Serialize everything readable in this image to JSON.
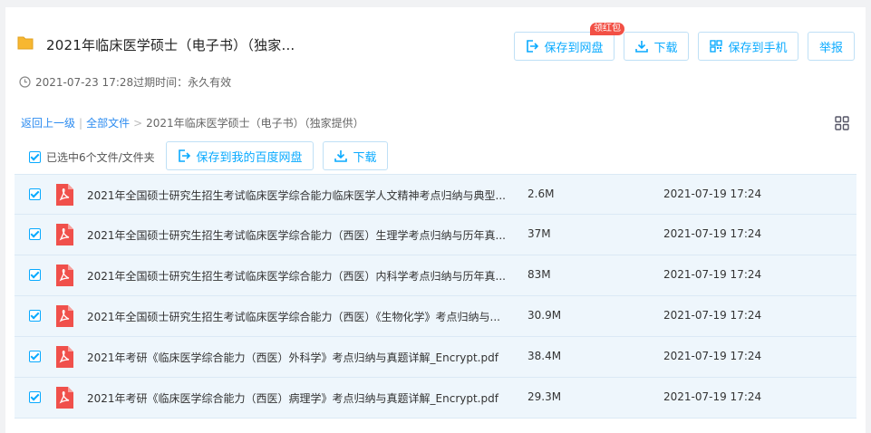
{
  "header": {
    "title": "2021年临床医学硕士（电子书）（独家...",
    "expire_text": "2021-07-23 17:28过期时间：永久有效",
    "badge": "领红包",
    "buttons": {
      "save_to_disk": "保存到网盘",
      "download": "下载",
      "save_to_phone": "保存到手机",
      "report": "举报"
    }
  },
  "breadcrumb": {
    "back": "返回上一级",
    "sep": "|",
    "all_files": "全部文件",
    "arrow": ">",
    "current": "2021年临床医学硕士（电子书）（独家提供）"
  },
  "toolbar": {
    "selected_label": "已选中6个文件/文件夹",
    "save_baidu": "保存到我的百度网盘",
    "download": "下载"
  },
  "files": [
    {
      "name": "2021年全国硕士研究生招生考试临床医学综合能力临床医学人文精神考点归纳与典型...",
      "size": "2.6M",
      "date": "2021-07-19 17:24"
    },
    {
      "name": "2021年全国硕士研究生招生考试临床医学综合能力（西医）生理学考点归纳与历年真...",
      "size": "37M",
      "date": "2021-07-19 17:24"
    },
    {
      "name": "2021年全国硕士研究生招生考试临床医学综合能力（西医）内科学考点归纳与历年真...",
      "size": "83M",
      "date": "2021-07-19 17:24"
    },
    {
      "name": "2021年全国硕士研究生招生考试临床医学综合能力（西医）《生物化学》考点归纳与...",
      "size": "30.9M",
      "date": "2021-07-19 17:24"
    },
    {
      "name": "2021年考研《临床医学综合能力（西医）外科学》考点归纳与真题详解_Encrypt.pdf",
      "size": "38.4M",
      "date": "2021-07-19 17:24"
    },
    {
      "name": "2021年考研《临床医学综合能力（西医）病理学》考点归纳与真题详解_Encrypt.pdf",
      "size": "29.3M",
      "date": "2021-07-19 17:24"
    }
  ],
  "colors": {
    "accent": "#09aaff",
    "link": "#2d8cf0",
    "folder": "#f7b731",
    "pdf": "#f0504b",
    "badge": "#f25045",
    "row_bg": "#eef6fc"
  },
  "icons": [
    "folder-icon",
    "clock-icon",
    "save-icon",
    "download-icon",
    "qrcode-icon",
    "grid-view-icon",
    "pdf-icon"
  ]
}
